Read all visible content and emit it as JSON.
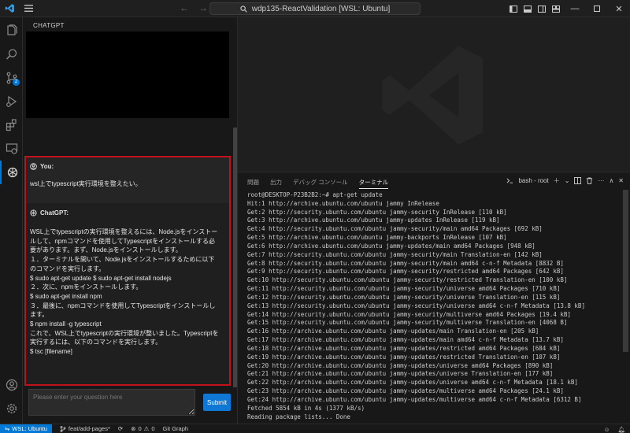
{
  "titlebar": {
    "search_text": "wdp135-ReactValidation [WSL: Ubuntu]"
  },
  "sidebar": {
    "title": "CHATGPT",
    "you_label": "You:",
    "you_message": "wsl上でtypescript実行環境を整えたい。",
    "gpt_label": "ChatGPT:",
    "gpt_lines": [
      "WSL上でtypescriptの実行環境を整えるには、Node.jsをインストー",
      "ルして、npmコマンドを使用してTypescriptをインストールする必",
      "要があります。まず、Node.jsをインストールします。",
      "１．ターミナルを開いて、Node.jsをインストールするために以下",
      "のコマンドを実行します。",
      "$ sudo apt-get update $ sudo apt-get install nodejs",
      "２．次に、npmをインストールします。",
      "$ sudo apt-get install npm",
      "３．最後に、npmコマンドを使用してTypescriptをインストールし",
      "ます。",
      "$ npm install -g typescript",
      "これで、WSL上でtypescriptの実行環境が整いました。Typescriptを",
      "実行するには、以下のコマンドを実行します。",
      "$ tsc [filename]"
    ],
    "input_placeholder": "Please enter your question here",
    "submit_label": "Submit",
    "scm_badge": "2"
  },
  "panel": {
    "tabs": [
      "問題",
      "出力",
      "デバッグ コンソール",
      "ターミナル"
    ],
    "terminal_name": "bash - root",
    "terminal_lines": [
      "root@DESKTOP-P23B2B2:~# apt-get update",
      "Hit:1 http://archive.ubuntu.com/ubuntu jammy InRelease",
      "Get:2 http://security.ubuntu.com/ubuntu jammy-security InRelease [110 kB]",
      "Get:3 http://archive.ubuntu.com/ubuntu jammy-updates InRelease [119 kB]",
      "Get:4 http://security.ubuntu.com/ubuntu jammy-security/main amd64 Packages [692 kB]",
      "Get:5 http://archive.ubuntu.com/ubuntu jammy-backports InRelease [107 kB]",
      "Get:6 http://archive.ubuntu.com/ubuntu jammy-updates/main amd64 Packages [948 kB]",
      "Get:7 http://security.ubuntu.com/ubuntu jammy-security/main Translation-en [142 kB]",
      "Get:8 http://security.ubuntu.com/ubuntu jammy-security/main amd64 c-n-f Metadata [8832 B]",
      "Get:9 http://security.ubuntu.com/ubuntu jammy-security/restricted amd64 Packages [642 kB]",
      "Get:10 http://security.ubuntu.com/ubuntu jammy-security/restricted Translation-en [100 kB]",
      "Get:11 http://security.ubuntu.com/ubuntu jammy-security/universe amd64 Packages [710 kB]",
      "Get:12 http://security.ubuntu.com/ubuntu jammy-security/universe Translation-en [115 kB]",
      "Get:13 http://security.ubuntu.com/ubuntu jammy-security/universe amd64 c-n-f Metadata [13.8 kB]",
      "Get:14 http://security.ubuntu.com/ubuntu jammy-security/multiverse amd64 Packages [19.4 kB]",
      "Get:15 http://security.ubuntu.com/ubuntu jammy-security/multiverse Translation-en [4068 B]",
      "Get:16 http://archive.ubuntu.com/ubuntu jammy-updates/main Translation-en [205 kB]",
      "Get:17 http://archive.ubuntu.com/ubuntu jammy-updates/main amd64 c-n-f Metadata [13.7 kB]",
      "Get:18 http://archive.ubuntu.com/ubuntu jammy-updates/restricted amd64 Packages [684 kB]",
      "Get:19 http://archive.ubuntu.com/ubuntu jammy-updates/restricted Translation-en [107 kB]",
      "Get:20 http://archive.ubuntu.com/ubuntu jammy-updates/universe amd64 Packages [890 kB]",
      "Get:21 http://archive.ubuntu.com/ubuntu jammy-updates/universe Translation-en [177 kB]",
      "Get:22 http://archive.ubuntu.com/ubuntu jammy-updates/universe amd64 c-n-f Metadata [18.1 kB]",
      "Get:23 http://archive.ubuntu.com/ubuntu jammy-updates/multiverse amd64 Packages [24.1 kB]",
      "Get:24 http://archive.ubuntu.com/ubuntu jammy-updates/multiverse amd64 c-n-f Metadata [6312 B]",
      "Fetched 5854 kB in 4s (1377 kB/s)",
      "Reading package lists... Done"
    ]
  },
  "statusbar": {
    "remote": "WSL: Ubuntu",
    "branch": "feat/add-pages*",
    "errors": "0",
    "warnings": "0",
    "git_graph": "Git Graph"
  },
  "colors": {
    "accent": "#0078d4",
    "highlight_border": "#c0121b"
  }
}
